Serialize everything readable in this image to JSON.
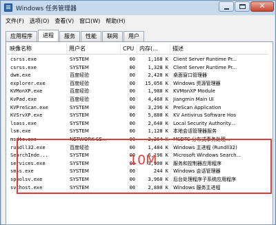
{
  "window": {
    "title": "Windows 任务管理器",
    "icon": "task-manager-icon",
    "close_label": "✕"
  },
  "menu": [
    "文件(F)",
    "选项(O)",
    "查看(V)",
    "窗口(W)",
    "帮助(H)"
  ],
  "tabs": [
    {
      "label": "应用程序",
      "active": false
    },
    {
      "label": "进程",
      "active": true
    },
    {
      "label": "服务",
      "active": false
    },
    {
      "label": "性能",
      "active": false
    },
    {
      "label": "联网",
      "active": false
    },
    {
      "label": "用户",
      "active": false
    }
  ],
  "columns": [
    "映像名称",
    "用户名",
    "CPU",
    "内存(...",
    "描述"
  ],
  "rows": [
    {
      "name": "csrss.exe",
      "user": "SYSTEM",
      "cpu": "00",
      "mem": "1,168 K",
      "desc": "Client Server Runtime Pr..."
    },
    {
      "name": "csrss.exe",
      "user": "SYSTEM",
      "cpu": "00",
      "mem": "1,328 K",
      "desc": "Client Server Runtime Pr..."
    },
    {
      "name": "dwm.exe",
      "user": "百度经验",
      "cpu": "00",
      "mem": "2,428 K",
      "desc": "桌面窗口管理器"
    },
    {
      "name": "explorer.exe",
      "user": "百度经验",
      "cpu": "00",
      "mem": "15,056 K",
      "desc": "Windows 资源管理器"
    },
    {
      "name": "KVMonXP.exe",
      "user": "百度经验",
      "cpu": "00",
      "mem": "1,988 K",
      "desc": "KVMonXP Module"
    },
    {
      "name": "KvPad.exe",
      "user": "百度经验",
      "cpu": "00",
      "mem": "4,460 K",
      "desc": "Jiangmin Main UI"
    },
    {
      "name": "KVPreScan.exe",
      "user": "SYSTEM",
      "cpu": "00",
      "mem": "3,296 K",
      "desc": "PreScan Application"
    },
    {
      "name": "KVSrvXP.exe",
      "user": "SYSTEM",
      "cpu": "00",
      "mem": "5,880 K",
      "desc": "KV Antivirus Software Hos"
    },
    {
      "name": "lsass.exe",
      "user": "SYSTEM",
      "cpu": "00",
      "mem": "2,640 K",
      "desc": "Local Security Authority..."
    },
    {
      "name": "lsm.exe",
      "user": "SYSTEM",
      "cpu": "00",
      "mem": "1,128 K",
      "desc": "本地会话管理器服务"
    },
    {
      "name": "msdtc.exe",
      "user": "NETWORK SE...",
      "cpu": "00",
      "mem": "2,264 K",
      "desc": "MSDTC 分布式事务处理..."
    },
    {
      "name": "rundll32.exe",
      "user": "百度经验",
      "cpu": "00",
      "mem": "1,484 K",
      "desc": "Windows 主进程 (Rundll32)"
    },
    {
      "name": "SearchInde...",
      "user": "SYSTEM",
      "cpu": "00",
      "mem": "6,196 K",
      "desc": "Microsoft Windows Search..."
    },
    {
      "name": "services.exe",
      "user": "SYSTEM",
      "cpu": "00",
      "mem": "3,900 K",
      "desc": "服务和控制器应用程序"
    },
    {
      "name": "smss.exe",
      "user": "SYSTEM",
      "cpu": "00",
      "mem": "244 K",
      "desc": "Windows 会话管理器"
    },
    {
      "name": "spoolsv.exe",
      "user": "SYSTEM",
      "cpu": "00",
      "mem": "3,960 K",
      "desc": "后台处理程序子系统应用程序"
    },
    {
      "name": "svchost.exe",
      "user": "SYSTEM",
      "cpu": "00",
      "mem": "2,880 K",
      "desc": "Windows 服务主进程"
    }
  ],
  "annotation": {
    "text": "10M",
    "color": "#e2423a"
  }
}
